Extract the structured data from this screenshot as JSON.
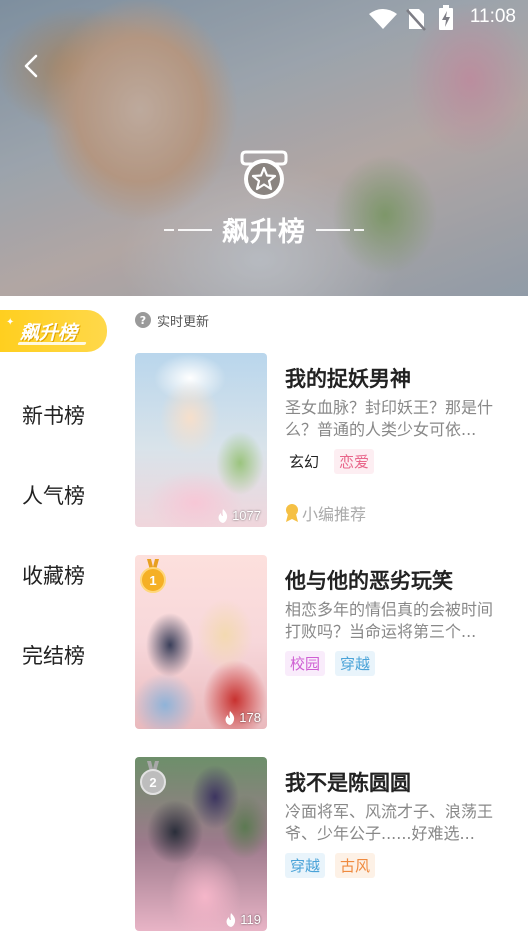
{
  "status_bar": {
    "time": "11:08"
  },
  "header": {
    "title": "飙升榜"
  },
  "sidebar": {
    "active_tab": "飙升榜",
    "items": [
      {
        "label": "新书榜"
      },
      {
        "label": "人气榜"
      },
      {
        "label": "收藏榜"
      },
      {
        "label": "完结榜"
      }
    ]
  },
  "list": {
    "notice": "实时更新",
    "books": [
      {
        "title": "我的捉妖男神",
        "desc": "圣女血脉？封印妖王？那是什么？普通的人类少女可依...",
        "tags": [
          "玄幻",
          "恋爱"
        ],
        "count": "1077",
        "extra": "小编推荐"
      },
      {
        "rank": "1",
        "title": "他与他的恶劣玩笑",
        "desc": "相恋多年的情侣真的会被时间打败吗？当命运将第三个...",
        "tags": [
          "校园",
          "穿越"
        ],
        "count": "178"
      },
      {
        "rank": "2",
        "title": "我不是陈圆圆",
        "desc": "冷面将军、风流才子、浪荡王爷、少年公子......好难选...",
        "tags": [
          "穿越",
          "古风"
        ],
        "count": "119"
      }
    ]
  },
  "colors": {
    "accent": "#ffcf1f",
    "gold": "#f5a623",
    "silver": "#b8b8b8"
  }
}
